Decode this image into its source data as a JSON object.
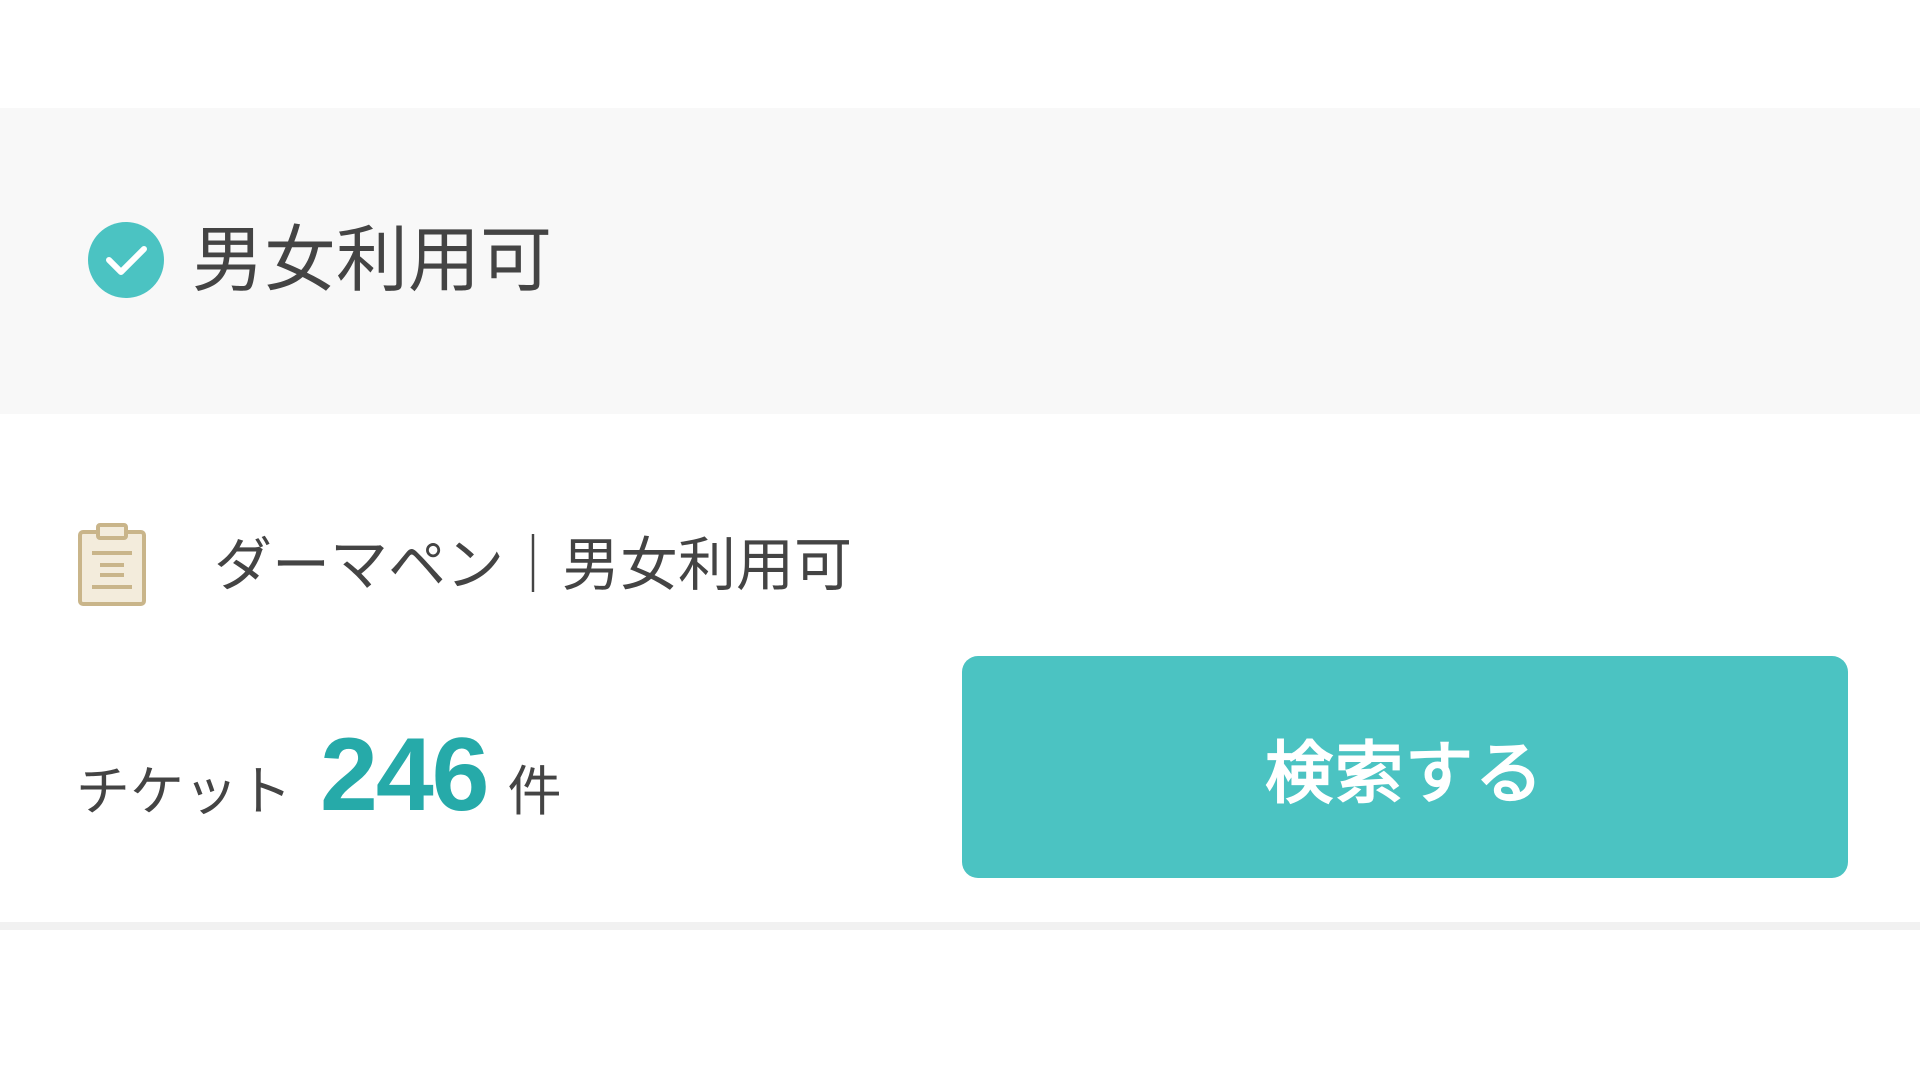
{
  "filter": {
    "label": "男女利用可",
    "checked": true,
    "icon": "check-circle-icon"
  },
  "summary": {
    "icon": "clipboard-icon",
    "text": "ダーマペン｜男女利用可"
  },
  "results": {
    "prefix": "チケット",
    "count": "246",
    "suffix": "件"
  },
  "actions": {
    "search_label": "検索する"
  },
  "colors": {
    "accent": "#4bc3c2",
    "count_text": "#26aaa9",
    "band_background": "#f8f8f8",
    "icon_gold": "#c9b58a"
  }
}
